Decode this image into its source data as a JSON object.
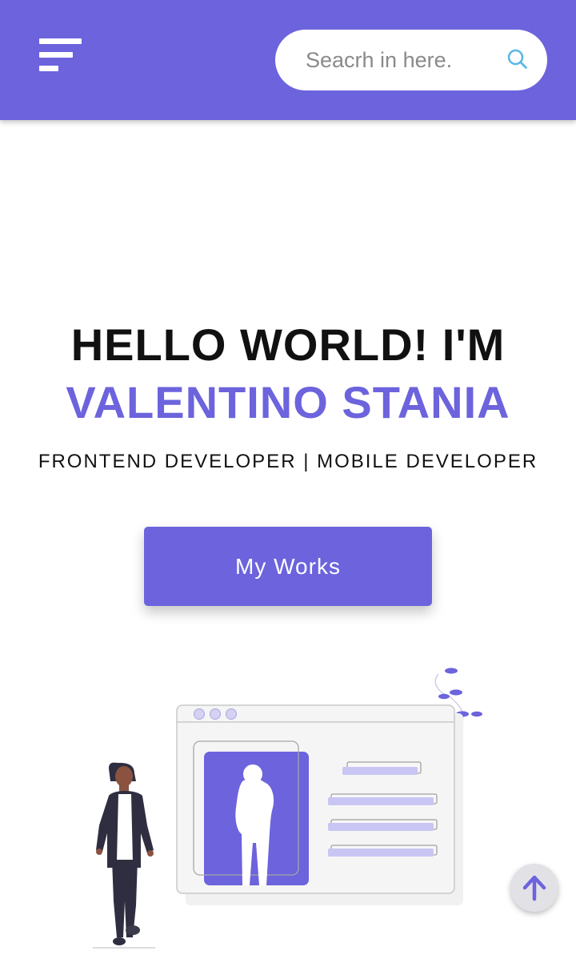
{
  "header": {
    "search_placeholder": "Seacrh in here."
  },
  "hero": {
    "line1": "HELLO WORLD! I'M",
    "name": "VALENTINO STANIA",
    "subtitle": "FRONTEND DEVELOPER | MOBILE DEVELOPER",
    "cta_label": "My Works"
  },
  "icons": {
    "menu": "hamburger-menu-icon",
    "search": "search-icon",
    "scroll_top": "arrow-up-icon"
  },
  "colors": {
    "accent": "#6c63dd",
    "search_icon": "#5ab8e6",
    "text": "#111111",
    "fab_bg": "#e2e2e6"
  }
}
